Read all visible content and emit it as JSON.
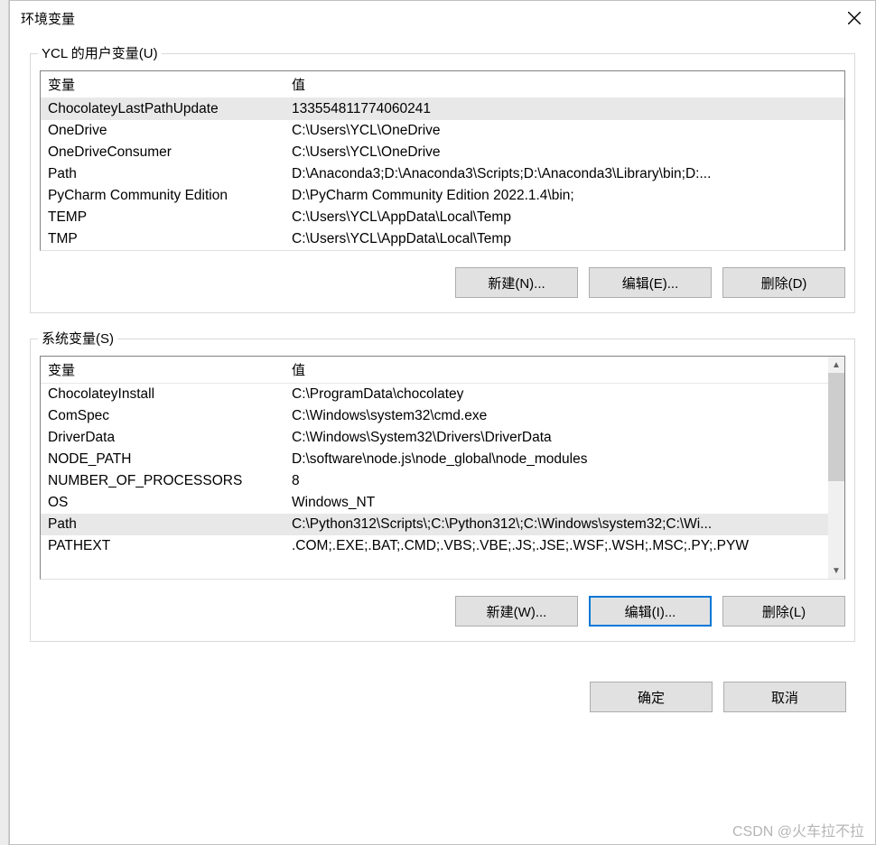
{
  "window": {
    "title": "环境变量"
  },
  "user_vars": {
    "legend": "YCL 的用户变量(U)",
    "headers": {
      "name": "变量",
      "value": "值"
    },
    "rows": [
      {
        "name": "ChocolateyLastPathUpdate",
        "value": "133554811774060241",
        "selected": true
      },
      {
        "name": "OneDrive",
        "value": "C:\\Users\\YCL\\OneDrive"
      },
      {
        "name": "OneDriveConsumer",
        "value": "C:\\Users\\YCL\\OneDrive"
      },
      {
        "name": "Path",
        "value": "D:\\Anaconda3;D:\\Anaconda3\\Scripts;D:\\Anaconda3\\Library\\bin;D:..."
      },
      {
        "name": "PyCharm Community Edition",
        "value": "D:\\PyCharm Community Edition 2022.1.4\\bin;"
      },
      {
        "name": "TEMP",
        "value": "C:\\Users\\YCL\\AppData\\Local\\Temp"
      },
      {
        "name": "TMP",
        "value": "C:\\Users\\YCL\\AppData\\Local\\Temp"
      }
    ],
    "buttons": {
      "new": "新建(N)...",
      "edit": "编辑(E)...",
      "delete": "删除(D)"
    }
  },
  "system_vars": {
    "legend": "系统变量(S)",
    "headers": {
      "name": "变量",
      "value": "值"
    },
    "rows": [
      {
        "name": "ChocolateyInstall",
        "value": "C:\\ProgramData\\chocolatey"
      },
      {
        "name": "ComSpec",
        "value": "C:\\Windows\\system32\\cmd.exe"
      },
      {
        "name": "DriverData",
        "value": "C:\\Windows\\System32\\Drivers\\DriverData"
      },
      {
        "name": "NODE_PATH",
        "value": "D:\\software\\node.js\\node_global\\node_modules"
      },
      {
        "name": "NUMBER_OF_PROCESSORS",
        "value": "8"
      },
      {
        "name": "OS",
        "value": "Windows_NT"
      },
      {
        "name": "Path",
        "value": "C:\\Python312\\Scripts\\;C:\\Python312\\;C:\\Windows\\system32;C:\\Wi...",
        "selected": true
      },
      {
        "name": "PATHEXT",
        "value": ".COM;.EXE;.BAT;.CMD;.VBS;.VBE;.JS;.JSE;.WSF;.WSH;.MSC;.PY;.PYW"
      }
    ],
    "buttons": {
      "new": "新建(W)...",
      "edit": "编辑(I)...",
      "delete": "删除(L)"
    }
  },
  "dialog": {
    "ok": "确定",
    "cancel": "取消"
  },
  "watermark": "CSDN @火车拉不拉"
}
